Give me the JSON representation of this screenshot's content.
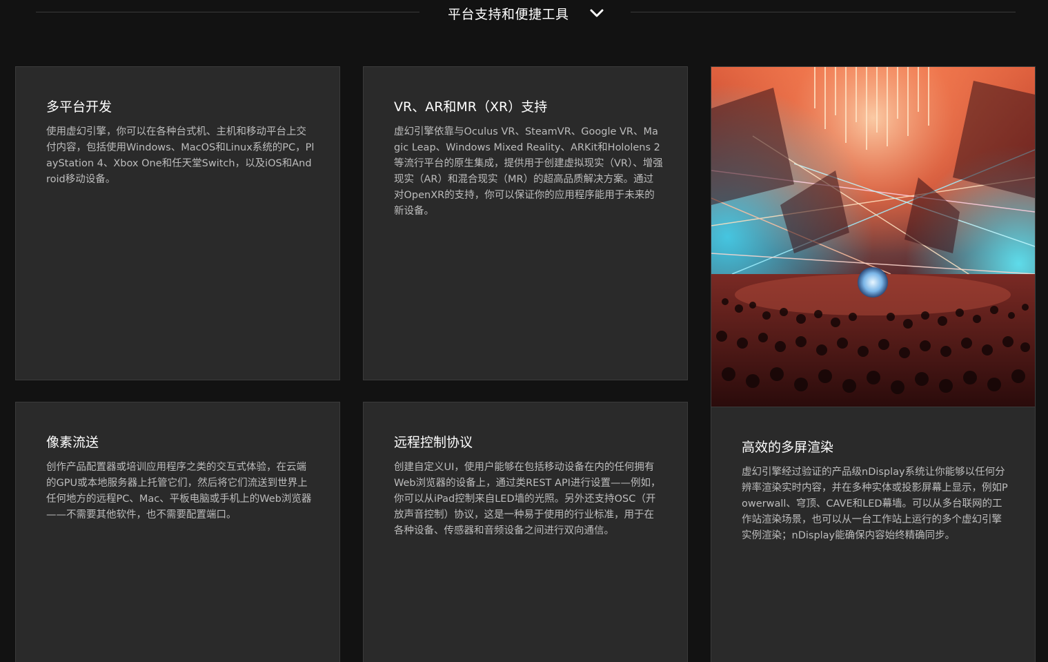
{
  "section": {
    "title": "平台支持和便捷工具",
    "toggle_icon": "chevron-down-icon"
  },
  "cards": {
    "multiplatform": {
      "title": "多平台开发",
      "body": "使用虚幻引擎，你可以在各种台式机、主机和移动平台上交付内容，包括使用Windows、MacOS和Linux系统的PC，PlayStation 4、Xbox One和任天堂Switch，以及iOS和Android移动设备。"
    },
    "xr": {
      "title": "VR、AR和MR（XR）支持",
      "body": "虚幻引擎依靠与Oculus VR、SteamVR、Google VR、Magic Leap、Windows Mixed Reality、ARKit和Hololens 2等流行平台的原生集成，提供用于创建虚拟现实（VR）、增强现实（AR）和混合现实（MR）的超高品质解决方案。通过对OpenXR的支持，你可以保证你的应用程序能用于未来的新设备。"
    },
    "pixel_streaming": {
      "title": "像素流送",
      "body": "创作产品配置器或培训应用程序之类的交互式体验，在云端的GPU或本地服务器上托管它们，然后将它们流送到世界上任何地方的远程PC、Mac、平板电脑或手机上的Web浏览器——不需要其他软件，也不需要配置端口。"
    },
    "remote_control": {
      "title": "远程控制协议",
      "body": "创建自定义UI，使用户能够在包括移动设备在内的任何拥有Web浏览器的设备上，通过类REST API进行设置——例如，你可以从iPad控制来自LED墙的光照。另外还支持OSC（开放声音控制）协议，这是一种易于使用的行业标准，用于在各种设备、传感器和音频设备之间进行双向通信。"
    },
    "ndisplay": {
      "title": "高效的多屏渲染",
      "body": "虚幻引擎经过验证的产品级nDisplay系统让你能够以任何分辨率渲染实时内容，并在多种实体或投影屏幕上显示，例如Powerwall、穹顶、CAVE和LED幕墙。可以从多台联网的工作站渲染场景，也可以从一台工作站上运行的多个虚幻引擎实例渲染；nDisplay能确保内容始终精确同步。",
      "image": "concert-venue-lasers-photo"
    }
  },
  "colors": {
    "page_bg": "#121212",
    "card_bg": "#2a2a2a",
    "card_border": "#3b3b3b",
    "body_text": "#bdbdbd",
    "title_text": "#ffffff"
  }
}
